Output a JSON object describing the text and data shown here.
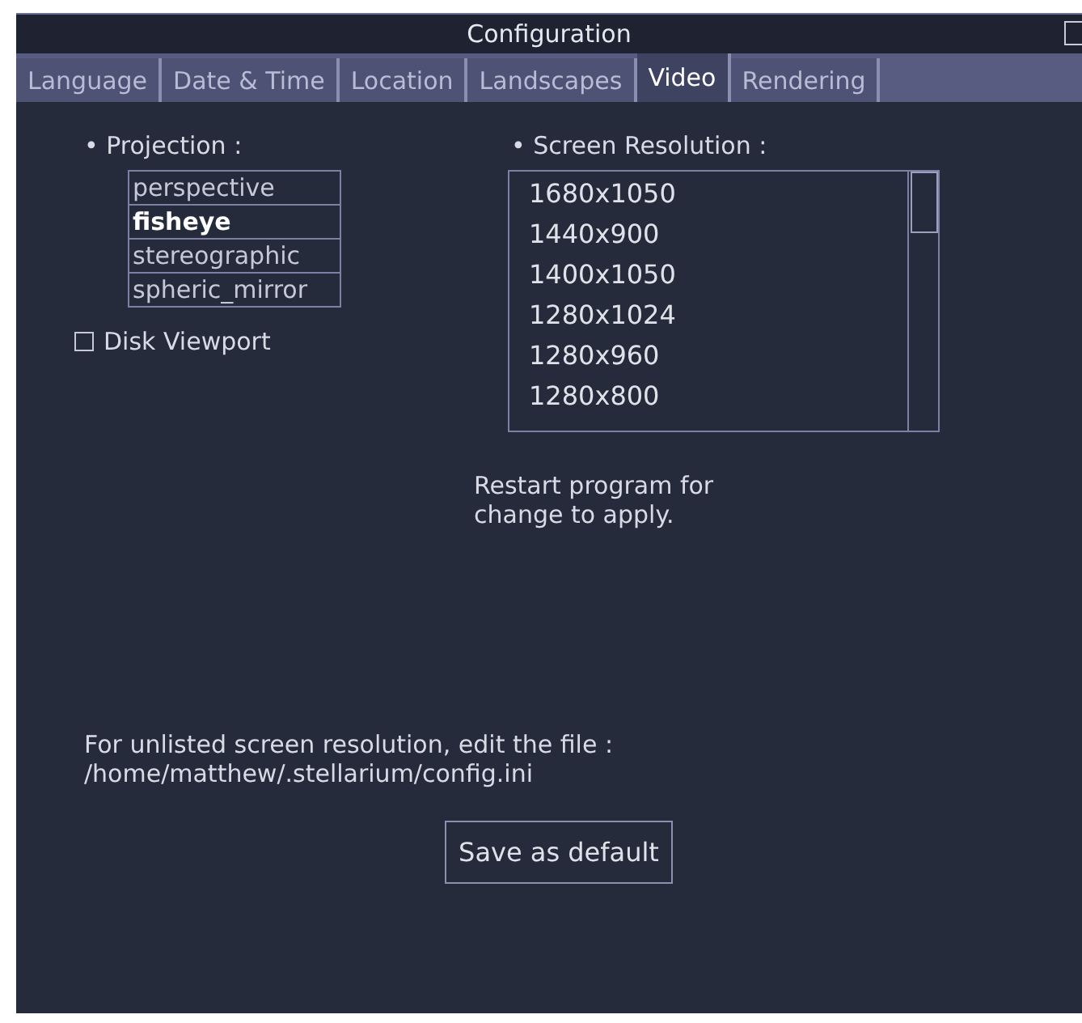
{
  "window": {
    "title": "Configuration"
  },
  "tabs": [
    {
      "label": "Language",
      "selected": false
    },
    {
      "label": "Date & Time",
      "selected": false
    },
    {
      "label": "Location",
      "selected": false
    },
    {
      "label": "Landscapes",
      "selected": false
    },
    {
      "label": "Video",
      "selected": true
    },
    {
      "label": "Rendering",
      "selected": false
    }
  ],
  "projection": {
    "bullet": "•",
    "label": "Projection :",
    "options": [
      {
        "label": "perspective",
        "selected": false
      },
      {
        "label": "fisheye",
        "selected": true
      },
      {
        "label": "stereographic",
        "selected": false
      },
      {
        "label": "spheric_mirror",
        "selected": false
      }
    ]
  },
  "disk_viewport": {
    "label": "Disk Viewport",
    "checked": false
  },
  "resolution": {
    "bullet": "•",
    "label": "Screen Resolution :",
    "options": [
      {
        "label": "1680x1050",
        "selected": false
      },
      {
        "label": "1440x900",
        "selected": false
      },
      {
        "label": "1400x1050",
        "selected": false
      },
      {
        "label": "1280x1024",
        "selected": false
      },
      {
        "label": "1280x960",
        "selected": false
      },
      {
        "label": "1280x800",
        "selected": false
      }
    ]
  },
  "restart_note": "Restart program for change to apply.",
  "unlisted_note": "For unlisted screen resolution, edit the file :",
  "config_path": "/home/matthew/.stellarium/config.ini",
  "save_button": "Save as default"
}
